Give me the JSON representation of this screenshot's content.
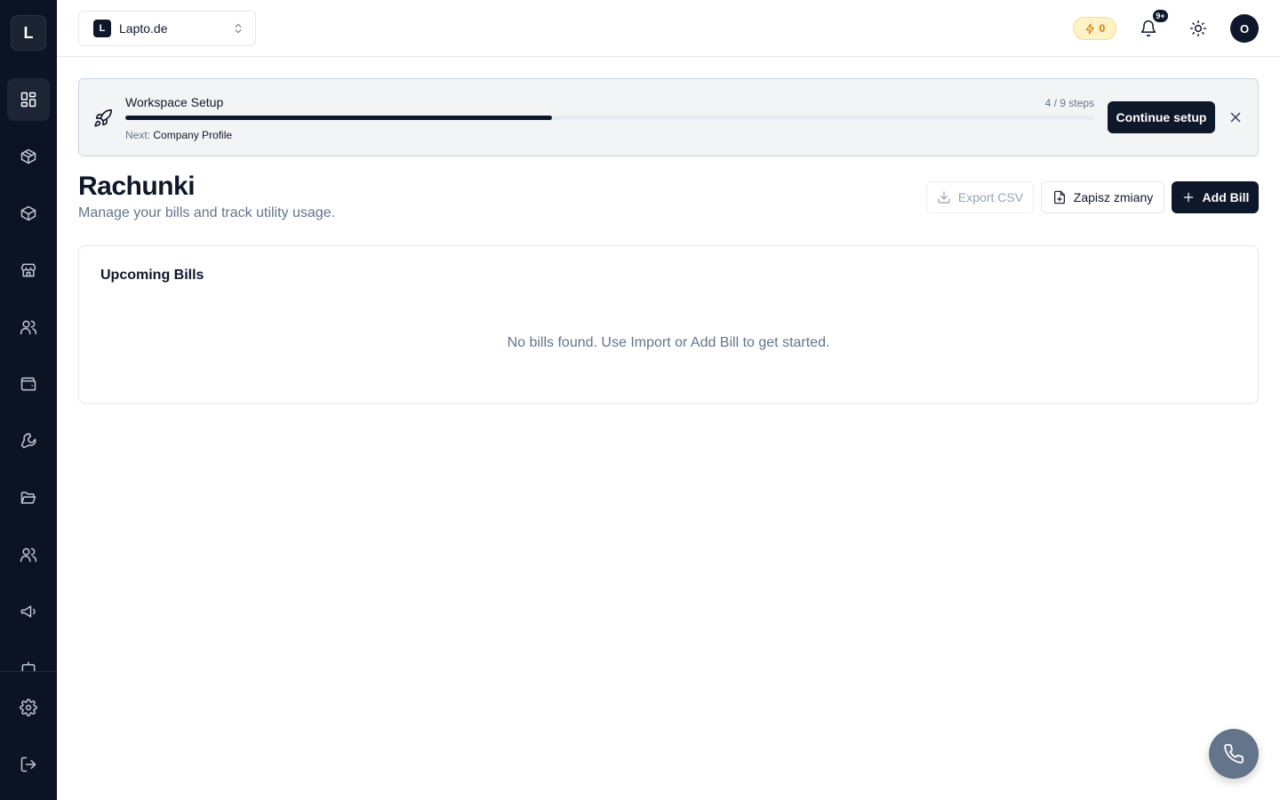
{
  "sidebar": {
    "logo_letter": "L",
    "items": [
      {
        "name": "dashboard"
      },
      {
        "name": "products"
      },
      {
        "name": "inventory"
      },
      {
        "name": "store"
      },
      {
        "name": "customers"
      },
      {
        "name": "wallet"
      },
      {
        "name": "tools"
      },
      {
        "name": "files"
      },
      {
        "name": "team"
      },
      {
        "name": "marketing"
      },
      {
        "name": "settings"
      },
      {
        "name": "logout"
      }
    ]
  },
  "header": {
    "workspace_badge": "L",
    "workspace_name": "Lapto.de",
    "credits": "0",
    "notifications_badge": "9+",
    "avatar_initial": "O"
  },
  "setup_banner": {
    "title": "Workspace Setup",
    "steps": "4 / 9 steps",
    "progress_fraction": 0.44,
    "next_label": "Next:",
    "next_step": "Company Profile",
    "continue_label": "Continue setup"
  },
  "page": {
    "title": "Rachunki",
    "subtitle": "Manage your bills and track utility usage.",
    "export_label": "Export CSV",
    "save_label": "Zapisz zmiany",
    "add_label": "Add Bill"
  },
  "upcoming": {
    "title": "Upcoming Bills",
    "empty_message": "No bills found. Use Import or Add Bill to get started."
  },
  "colors": {
    "sidebar_bg": "#0c1322",
    "primary": "#0f172a",
    "credits_accent": "#d97706",
    "fab_bg": "#64748b"
  }
}
